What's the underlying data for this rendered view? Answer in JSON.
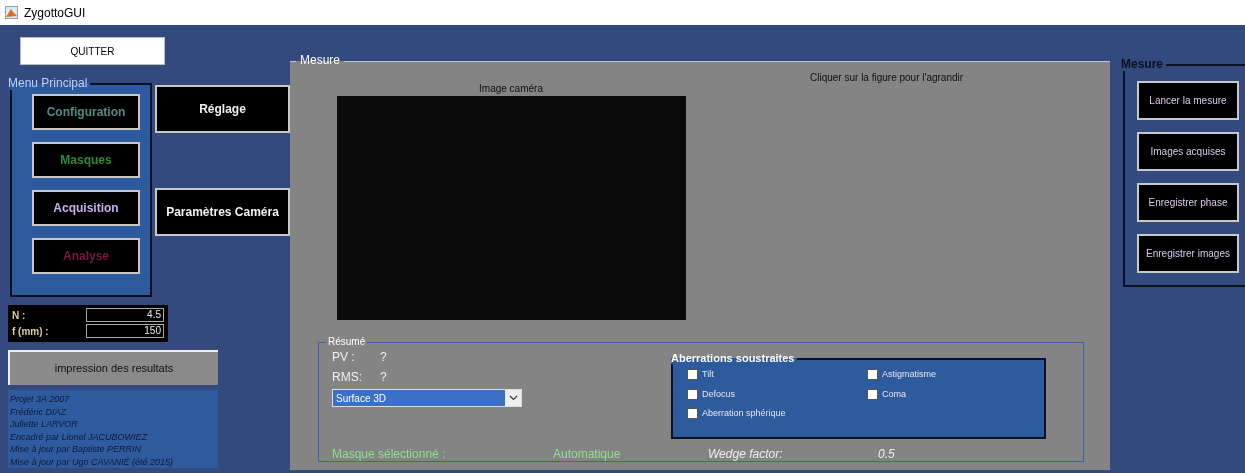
{
  "window": {
    "title": "ZygottoGUI"
  },
  "quit_button": "QUITTER",
  "main_menu": {
    "title": "Menu Principal",
    "items": [
      {
        "label": "Configuration",
        "kind": "setup"
      },
      {
        "label": "Masques",
        "kind": "masks"
      },
      {
        "label": "Acquisition",
        "kind": "capture"
      },
      {
        "label": "Analyse",
        "kind": "analysis"
      }
    ]
  },
  "side_buttons": [
    "Réglage",
    "Paramètres Caméra"
  ],
  "parameters": [
    {
      "label": "N :",
      "value": "4.5"
    },
    {
      "label": "f (mm) :",
      "value": "150"
    }
  ],
  "print_button": "impression des resultats",
  "credits": [
    "Projet 3A 2007",
    "Frédéric DIAZ",
    "Juliette LARVOR",
    "Encadré par Lionel JACUBOWIEZ",
    "Mise à jour par Baptiste PERRIN",
    "Mise à jour par Ugo CAVANIÉ (été 2015)"
  ],
  "measure_panel": {
    "title": "Mesure",
    "image_label": "Image caméra",
    "hint": "Cliquer sur la figure pour l'agrandir",
    "summary": {
      "title": "Résumé",
      "pv_label": "PV :",
      "pv_value": "?",
      "rms_label": "RMS:",
      "rms_value": "?",
      "view_select": "Surface 3D",
      "aberrations": {
        "title": "Aberrations soustraites",
        "items": [
          {
            "label": "Tilt",
            "checked": false
          },
          {
            "label": "Astigmatisme",
            "checked": false
          },
          {
            "label": "Defocus",
            "checked": false
          },
          {
            "label": "Coma",
            "checked": false
          },
          {
            "label": "Aberration sphérique",
            "checked": false
          }
        ]
      },
      "mask_label": "Masque sélectionné :",
      "mask_value": "Automatique",
      "wedge_label": "Wedge factor:",
      "wedge_value": "0.5"
    }
  },
  "measure_actions": {
    "title": "Mesure",
    "buttons": [
      "Lancer la mesure",
      "Images acquises",
      "Enregistrer phase",
      "Enregistrer images"
    ]
  }
}
